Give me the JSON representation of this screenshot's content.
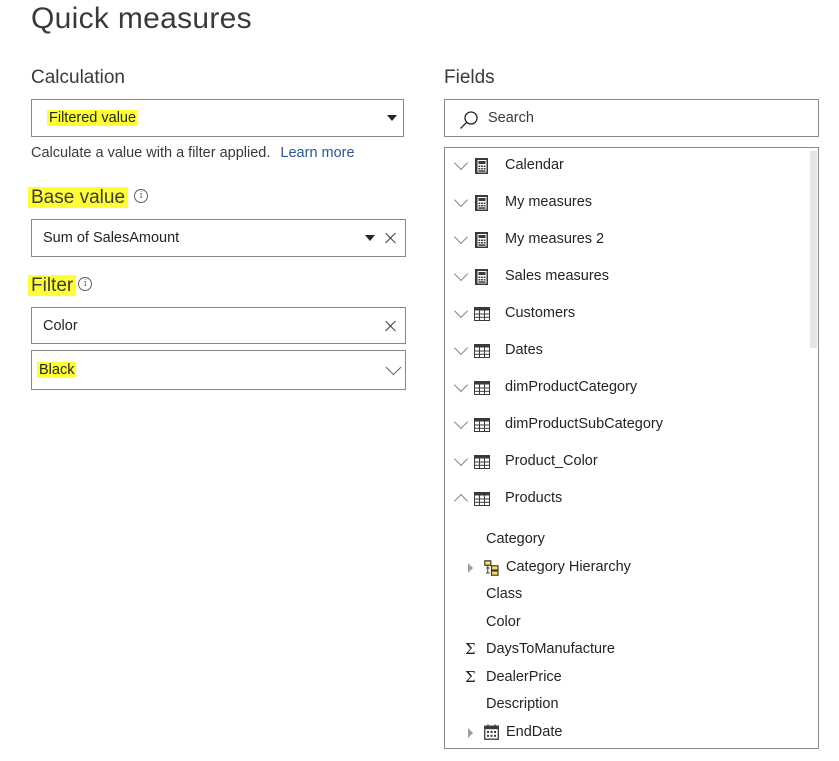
{
  "page": {
    "title": "Quick measures"
  },
  "calculation": {
    "label": "Calculation",
    "selected": "Filtered value",
    "description": "Calculate a value with a filter applied.",
    "learn_more": "Learn more"
  },
  "base_value": {
    "label": "Base value",
    "info": "i",
    "value": "Sum of SalesAmount"
  },
  "filter": {
    "label": "Filter",
    "info": "i",
    "field": "Color",
    "value": "Black"
  },
  "fields": {
    "label": "Fields",
    "search_placeholder": "Search",
    "tables": [
      {
        "name": "Calendar",
        "icon": "calculator-icon",
        "expanded": false
      },
      {
        "name": "My measures",
        "icon": "calculator-icon",
        "expanded": false
      },
      {
        "name": "My measures 2",
        "icon": "calculator-icon",
        "expanded": false
      },
      {
        "name": "Sales measures",
        "icon": "calculator-icon",
        "expanded": false
      },
      {
        "name": "Customers",
        "icon": "table-icon",
        "expanded": false
      },
      {
        "name": "Dates",
        "icon": "table-icon",
        "expanded": false
      },
      {
        "name": "dimProductCategory",
        "icon": "table-icon",
        "expanded": false
      },
      {
        "name": "dimProductSubCategory",
        "icon": "table-icon",
        "expanded": false
      },
      {
        "name": "Product_Color",
        "icon": "table-icon",
        "expanded": false
      },
      {
        "name": "Products",
        "icon": "table-icon",
        "expanded": true
      }
    ],
    "product_fields": [
      {
        "name": "Category",
        "icon": "none"
      },
      {
        "name": "Category Hierarchy",
        "icon": "hierarchy-icon"
      },
      {
        "name": "Class",
        "icon": "none"
      },
      {
        "name": "Color",
        "icon": "none"
      },
      {
        "name": "DaysToManufacture",
        "icon": "sigma-icon"
      },
      {
        "name": "DealerPrice",
        "icon": "sigma-icon"
      },
      {
        "name": "Description",
        "icon": "none"
      },
      {
        "name": "EndDate",
        "icon": "calendar-icon"
      }
    ],
    "sigma_glyph": "Σ"
  },
  "colors": {
    "highlight": "#ffff36",
    "link": "#2b579a",
    "hierarchy_icon": "#c9a800"
  }
}
